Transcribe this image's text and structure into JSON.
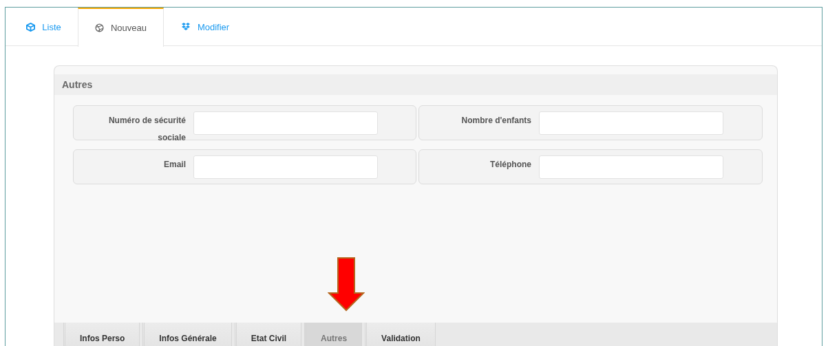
{
  "top_tabs": [
    {
      "label": "Liste",
      "selected": false
    },
    {
      "label": "Nouveau",
      "selected": true
    },
    {
      "label": "Modifier",
      "selected": false
    }
  ],
  "section": {
    "title": "Autres"
  },
  "fields": [
    {
      "label": "Numéro de sécurité sociale"
    },
    {
      "label": "Nombre d'enfants"
    },
    {
      "label": "Email"
    },
    {
      "label": "Téléphone"
    }
  ],
  "step_tabs": [
    {
      "label": "Infos Perso",
      "selected": false
    },
    {
      "label": "Infos Générale",
      "selected": false
    },
    {
      "label": "Etat Civil",
      "selected": false
    },
    {
      "label": "Autres",
      "selected": true
    },
    {
      "label": "Validation",
      "selected": false
    }
  ]
}
